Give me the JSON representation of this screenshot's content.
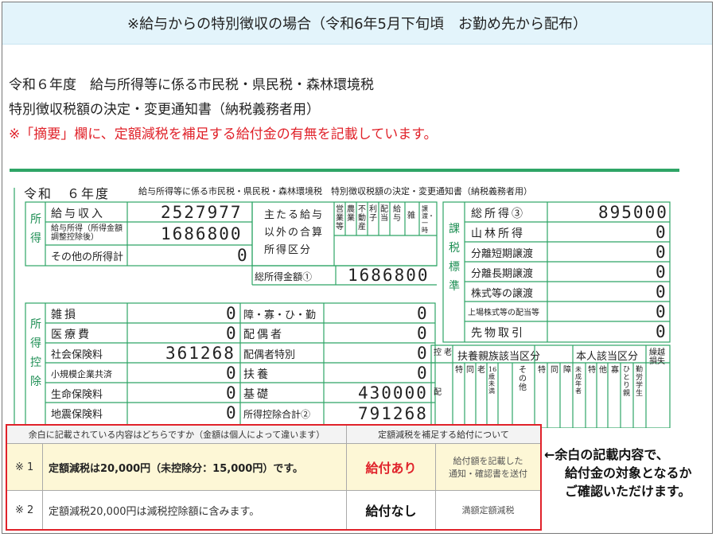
{
  "banner": {
    "title": "※給与からの特別徴収の場合（令和6年5月下旬頃　お勤め先から配布）"
  },
  "intro": {
    "line1": "令和６年度　給与所得等に係る市民税・県民税・森林環境税",
    "line2": "特別徴収税額の決定・変更通知書（納税義務者用）",
    "line3": "※「摘要」欄に、定額減税を補足する給付金の有無を記載しています。"
  },
  "form": {
    "header": "令和　６年度",
    "header_sub": "給与所得等に係る市民税・県民税・森林環境税　特別徴収税額の決定・変更通知書（納税義務者用）",
    "income_group": "所得",
    "income_rows": [
      {
        "label": "給与収入",
        "value": "2527977"
      },
      {
        "label": "給与所得（所得金額調整控除後）",
        "value": "1686800"
      },
      {
        "label": "その他の所得計",
        "value": "0"
      }
    ],
    "main_income_label": [
      "主たる給与",
      "以外の合算",
      "所得区分"
    ],
    "category_headers": [
      "営業等",
      "農業",
      "不動産",
      "利子",
      "配当",
      "給与",
      "雑",
      "譲渡・一時"
    ],
    "total_income_label": "総所得金額①",
    "total_income_value": "1686800",
    "deduction_group": "所得控除",
    "deduction_left": [
      {
        "label": "雑損",
        "value": "0"
      },
      {
        "label": "医療費",
        "value": "0"
      },
      {
        "label": "社会保険料",
        "value": "361268"
      },
      {
        "label": "小規模企業共済",
        "value": "0"
      },
      {
        "label": "生命保険料",
        "value": "0"
      },
      {
        "label": "地震保険料",
        "value": "0"
      }
    ],
    "deduction_right": [
      {
        "label": "障・寡・ひ・勤",
        "value": "0"
      },
      {
        "label": "配偶者",
        "value": "0"
      },
      {
        "label": "配偶者特別",
        "value": "0"
      },
      {
        "label": "扶養",
        "value": "0"
      },
      {
        "label": "基礎",
        "value": "430000"
      },
      {
        "label": "所得控除合計②",
        "value": "791268"
      }
    ],
    "tax_base_group": "課税標準",
    "tax_base_rows": [
      {
        "label": "総所得③",
        "value": "895000"
      },
      {
        "label": "山林所得",
        "value": "0"
      },
      {
        "label": "分離短期譲渡",
        "value": "0"
      },
      {
        "label": "分離長期譲渡",
        "value": "0"
      },
      {
        "label": "株式等の譲渡",
        "value": "0"
      },
      {
        "label": "上場株式等の配当等",
        "value": "0"
      },
      {
        "label": "先物取引",
        "value": "0"
      }
    ],
    "dependents_headers": [
      "控",
      "老",
      "扶養親族該当区分",
      "本人該当区分",
      "繰越損失"
    ],
    "dependents_sub": [
      "配",
      "特",
      "同",
      "老",
      "16歳未満",
      "その他",
      "特",
      "同",
      "障",
      "未成年者",
      "特",
      "他",
      "寡",
      "ひとり親",
      "勤労学生"
    ]
  },
  "summary_table": {
    "col1_header": "余白に記載されている内容はどちらですか（金額は個人によって違います）",
    "col2_header": "定額減税を補足する給付について",
    "rows": [
      {
        "mark": "※ 1",
        "text": "定額減税は20,000円（未控除分：15,000円）です。",
        "result": "給付あり",
        "note": "給付額を記載した\n通知・確認書を送付"
      },
      {
        "mark": "※ 2",
        "text": "定額減税20,000円は減税控除額に含みます。",
        "result": "給付なし",
        "note": "満額定額減税"
      }
    ]
  },
  "side_note": {
    "lines": [
      "←余白の記載内容で、",
      "給付金の対象となるか",
      "ご確認いただけます。"
    ]
  },
  "colors": {
    "accent_red": "#e0222a",
    "form_green": "#1f8f55",
    "banner_bg": "#e3f4fb",
    "highlight_row": "#fdf7d6"
  }
}
